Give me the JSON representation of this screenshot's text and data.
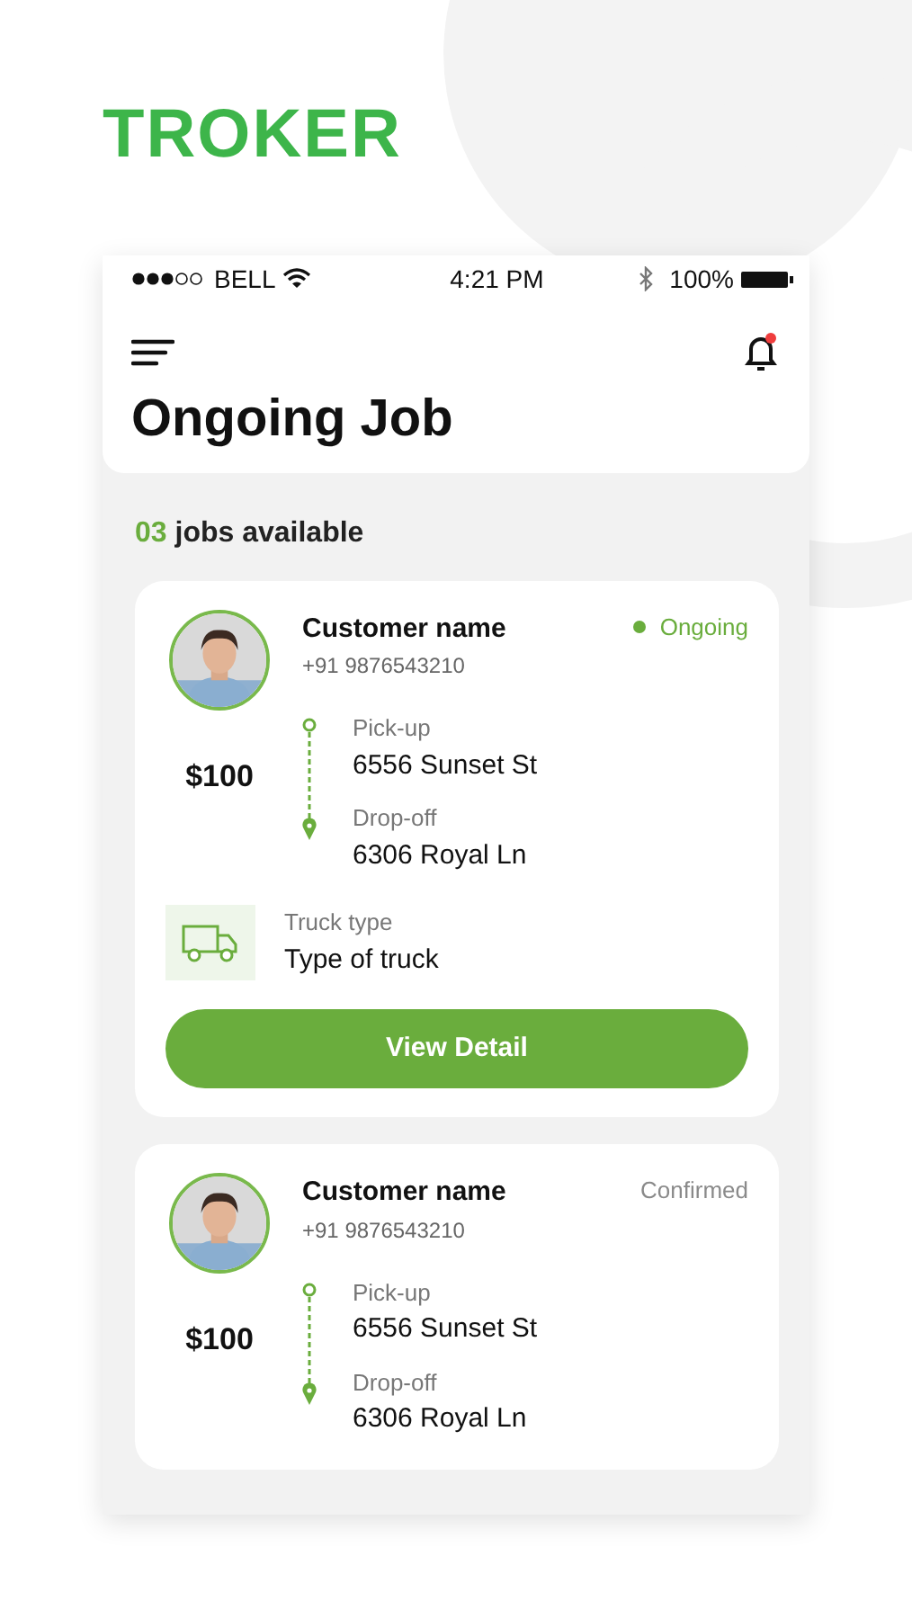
{
  "logo": "TROKER",
  "status_bar": {
    "carrier": "BELL",
    "time": "4:21 PM",
    "battery": "100%"
  },
  "header": {
    "title": "Ongoing Job"
  },
  "summary": {
    "count": "03",
    "label": "jobs available"
  },
  "jobs": [
    {
      "name": "Customer name",
      "phone": "+91 9876543210",
      "status": {
        "text": "Ongoing",
        "kind": "ongoing"
      },
      "price": "$100",
      "pickup_label": "Pick-up",
      "pickup": "6556 Sunset St",
      "dropoff_label": "Drop-off",
      "dropoff": "6306 Royal Ln",
      "truck": {
        "label": "Truck type",
        "value": "Type of truck"
      },
      "button": "View Detail"
    },
    {
      "name": "Customer name",
      "phone": "+91 9876543210",
      "status": {
        "text": "Confirmed",
        "kind": "confirmed"
      },
      "price": "$100",
      "pickup_label": "Pick-up",
      "pickup": "6556 Sunset St",
      "dropoff_label": "Drop-off",
      "dropoff": "6306 Royal Ln"
    }
  ]
}
